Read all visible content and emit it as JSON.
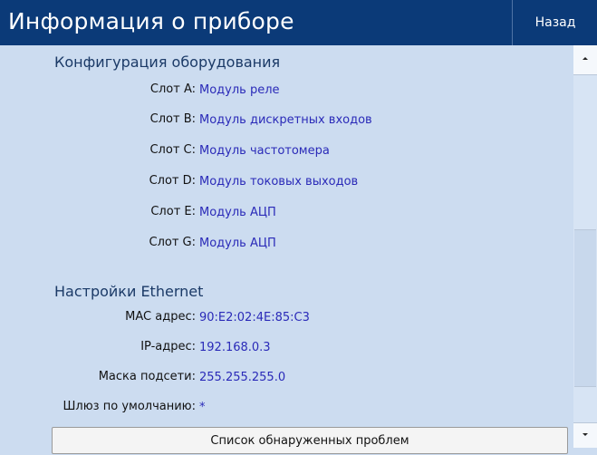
{
  "header": {
    "title": "Информация о приборе",
    "back_label": "Назад"
  },
  "hardware": {
    "section_title": "Конфигурация оборудования",
    "slots": [
      {
        "label": "Слот A:",
        "value": "Модуль реле"
      },
      {
        "label": "Слот B:",
        "value": "Модуль дискретных входов"
      },
      {
        "label": "Слот C:",
        "value": "Модуль частотомера"
      },
      {
        "label": "Слот D:",
        "value": "Модуль токовых выходов"
      },
      {
        "label": "Слот E:",
        "value": "Модуль АЦП"
      },
      {
        "label": "Слот G:",
        "value": "Модуль АЦП"
      }
    ]
  },
  "ethernet": {
    "section_title": "Настройки Ethernet",
    "fields": [
      {
        "label": "MAC адрес:",
        "value": "90:E2:02:4E:85:C3"
      },
      {
        "label": "IP-адрес:",
        "value": "192.168.0.3"
      },
      {
        "label": "Маска подсети:",
        "value": "255.255.255.0"
      },
      {
        "label": "Шлюз по умолчанию:",
        "value": "*"
      }
    ]
  },
  "problems_button_label": "Список обнаруженных проблем",
  "colors": {
    "titlebar": "#0b3a78",
    "background": "#ccdcf0",
    "value_text": "#2a2ab8",
    "section_text": "#1b3a67"
  }
}
